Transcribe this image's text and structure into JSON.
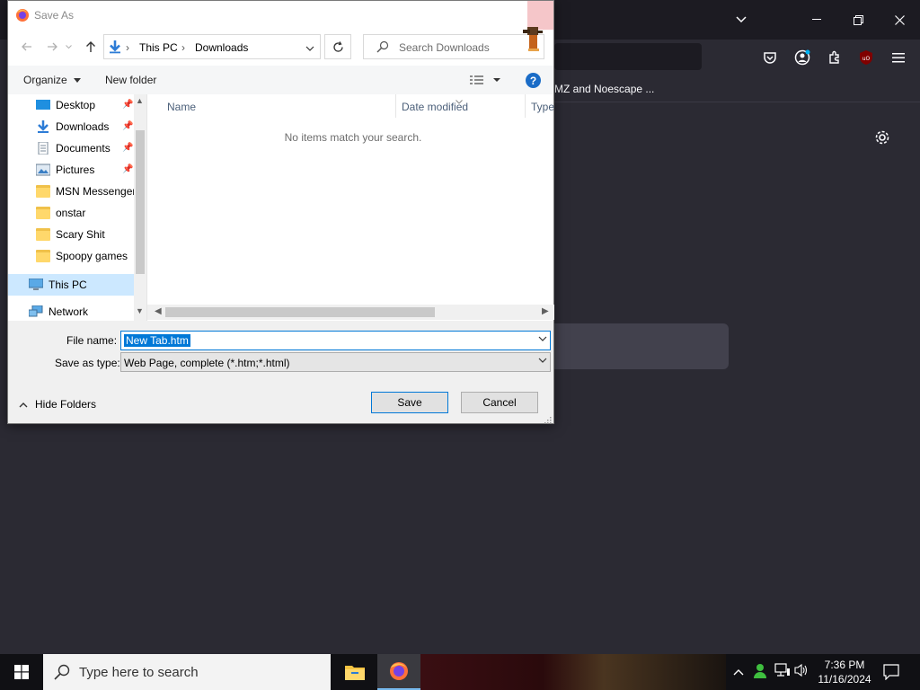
{
  "browser": {
    "bookmark_text": "MZ and Noescape ..."
  },
  "dialog": {
    "title": "Save As",
    "path": [
      "This PC",
      "Downloads"
    ],
    "search_placeholder": "Search Downloads",
    "commands": {
      "organize": "Organize",
      "new_folder": "New folder",
      "help": "?"
    },
    "nav_items": [
      {
        "label": "Desktop",
        "icon": "desktop-icon",
        "pinned": true
      },
      {
        "label": "Downloads",
        "icon": "downloads-icon",
        "pinned": true
      },
      {
        "label": "Documents",
        "icon": "documents-icon",
        "pinned": true
      },
      {
        "label": "Pictures",
        "icon": "pictures-icon",
        "pinned": true
      },
      {
        "label": "MSN Messenger",
        "icon": "folder-icon",
        "pinned": false
      },
      {
        "label": "onstar",
        "icon": "folder-icon",
        "pinned": false
      },
      {
        "label": "Scary Shit",
        "icon": "folder-icon",
        "pinned": false
      },
      {
        "label": "Spoopy games",
        "icon": "folder-icon",
        "pinned": false
      },
      {
        "label": "This PC",
        "icon": "computer-icon",
        "pinned": false,
        "selected": true
      },
      {
        "label": "Network",
        "icon": "network-icon",
        "pinned": false
      }
    ],
    "columns": [
      "Name",
      "Date modified",
      "Type"
    ],
    "empty_message": "No items match your search.",
    "file_name_label": "File name:",
    "file_name_value": "New Tab.htm",
    "save_type_label": "Save as type:",
    "save_type_value": "Web Page, complete (*.htm;*.html)",
    "hide_folders": "Hide Folders",
    "save_button": "Save",
    "cancel_button": "Cancel"
  },
  "taskbar": {
    "search_placeholder": "Type here to search",
    "time": "7:36 PM",
    "date": "11/16/2024"
  },
  "colors": {
    "accent": "#0078d7",
    "selection": "#cce8ff",
    "browser_bg": "#2b2a33"
  }
}
